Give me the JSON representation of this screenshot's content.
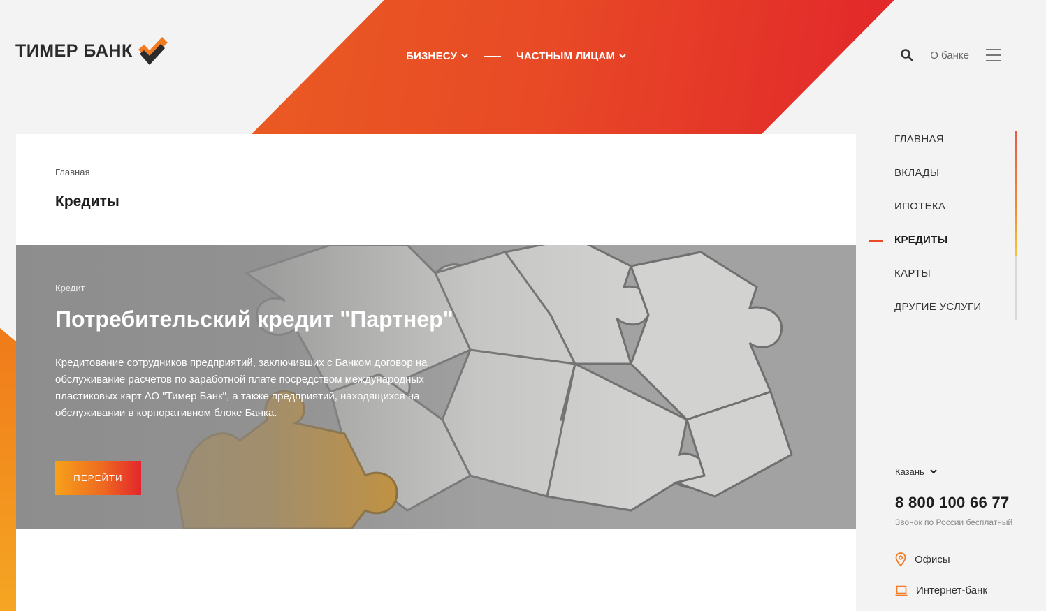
{
  "brand": {
    "name": "ТИМЕР БАНК",
    "accent": "#e84a26"
  },
  "topnav": {
    "items": [
      {
        "label": "БИЗНЕСУ"
      },
      {
        "label": "ЧАСТНЫМ ЛИЦАМ"
      }
    ]
  },
  "header": {
    "about_label": "О банке"
  },
  "breadcrumb": {
    "home": "Главная"
  },
  "page": {
    "title": "Кредиты"
  },
  "promo": {
    "tag": "Кредит",
    "title": "Потребительский кредит \"Партнер\"",
    "text": "Кредитование сотрудников предприятий, заключивших с Банком договор на обслуживание расчетов по заработной плате посредством международных пластиковых карт АО \"Тимер Банк\", а также предприятий, находящихся на обслуживании в корпоративном блоке Банка.",
    "button": "ПЕРЕЙТИ"
  },
  "side_menu": {
    "items": [
      {
        "label": "ГЛАВНАЯ"
      },
      {
        "label": "ВКЛАДЫ"
      },
      {
        "label": "ИПОТЕКА"
      },
      {
        "label": "КРЕДИТЫ",
        "active": true
      },
      {
        "label": "КАРТЫ"
      },
      {
        "label": "ДРУГИЕ УСЛУГИ"
      }
    ],
    "scroll_progress": 0.66
  },
  "contacts": {
    "city": "Казань",
    "phone": "8 800 100 66 77",
    "phone_note": "Звонок по России бесплатный",
    "offices": "Офисы",
    "internet_bank": "Интернет-банк"
  },
  "icons": [
    "search-icon",
    "menu-icon",
    "chevron-down-icon",
    "location-pin-icon",
    "laptop-icon",
    "logo-checkmark-icon"
  ]
}
